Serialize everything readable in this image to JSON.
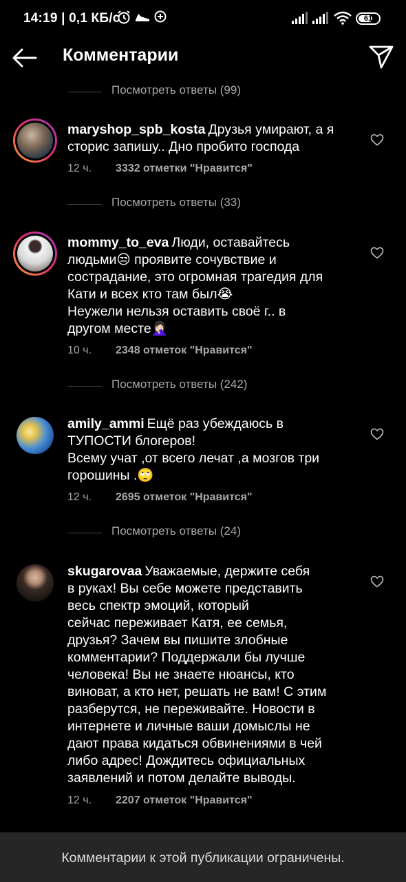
{
  "status_bar": {
    "text": "14:19 | 0,1 КБ/с",
    "battery": "61"
  },
  "header": {
    "title": "Комментарии"
  },
  "view_replies": [
    "Посмотреть ответы (99)",
    "Посмотреть ответы (33)",
    "Посмотреть ответы (242)",
    "Посмотреть ответы (24)"
  ],
  "comments": [
    {
      "username": "maryshop_spb_kosta",
      "text": "Друзья умирают, а я\nсторис запишу.. Дно пробито господа",
      "time": "12 ч.",
      "likes": "3332 отметки \"Нравится\""
    },
    {
      "username": "mommy_to_eva",
      "text": "Люди, оставайтесь\nлюдьми😒 проявите сочувствие и\nсострадание, это огромная трагедия для\nКати и всех кто там был😭\nНеужели нельзя оставить своё г.. в\nдругом месте🤦🏻‍♀️",
      "time": "10 ч.",
      "likes": "2348 отметок \"Нравится\""
    },
    {
      "username": "amily_ammi",
      "text": "Ещё раз убеждаюсь в\nТУПОСТИ блогеров!\nВсему учат ,от всего лечат ,а мозгов три\nгорошины .🙄",
      "time": "12 ч.",
      "likes": "2695 отметок \"Нравится\""
    },
    {
      "username": "skugarovaa",
      "text": "Уважаемые, держите себя\nв руках! Вы себе можете представить\nвесь спектр эмоций, который\nсейчас переживает Катя, ее семья,\nдрузья? Зачем вы пишите злобные\nкомментарии? Поддержали бы лучше\nчеловека! Вы не знаете нюансы, кто\nвиноват, а кто нет, решать не вам! С этим\nразберутся, не переживайте. Новости в\nинтернете и личные ваши домыслы не\nдают права кидаться обвинениями в чей\nлибо адрес! Дождитесь официальных\nзаявлений и потом делайте выводы.",
      "time": "12 ч.",
      "likes": "2207 отметок \"Нравится\""
    }
  ],
  "footer": {
    "text": "Комментарии к этой публикации ограничены."
  },
  "colors": {
    "background": "#000000",
    "secondary_text": "#a8a8a8",
    "bottom_bar": "#262626"
  }
}
